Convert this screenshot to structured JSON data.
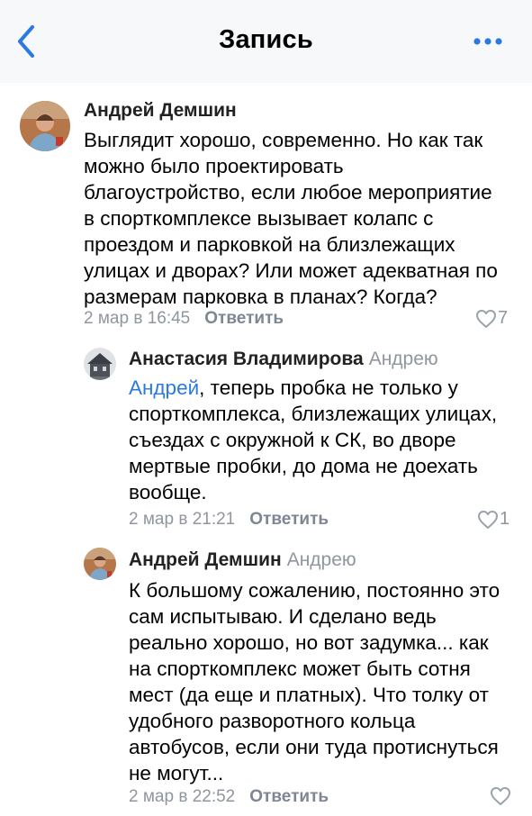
{
  "header": {
    "title": "Запись",
    "back_icon": "chevron-left-icon",
    "more_icon": "ellipsis-icon",
    "accent_color": "#2a7ae0"
  },
  "comments": [
    {
      "author": "Андрей Демшин",
      "reply_to": "",
      "mention": "",
      "text": "Выглядит хорошо, современно. Но как так можно было проектировать благоустройство, если любое мероприятие в спорткомплексе вызывает колапс с проездом и парковкой на близлежащих улицах и дворах? Или может адекватная по размерам парковка в планах? Когда?",
      "date": "2 мар в 16:45",
      "reply_label": "Ответить",
      "likes": "7"
    },
    {
      "author": "Анастасия Владимирова",
      "reply_to": "Андрею",
      "mention": "Андрей",
      "text": ", теперь пробка не только у спорткомплекса, близлежащих улицах, съездах с окружной к СК, во дворе мертвые пробки, до дома не доехать вообще.",
      "date": "2 мар в 21:21",
      "reply_label": "Ответить",
      "likes": "1"
    },
    {
      "author": "Андрей Демшин",
      "reply_to": "Андрею",
      "mention": "",
      "text": "К большому сожалению, постоянно это сам испытываю. И сделано ведь реально хорошо, но вот задумка... как на спорткомплекс может быть сотня мест (да еще и платных). Что толку от удобного разворотного кольца автобусов, если они туда протиснуться не могут...",
      "date": "2 мар в 22:52",
      "reply_label": "Ответить",
      "likes": ""
    }
  ]
}
